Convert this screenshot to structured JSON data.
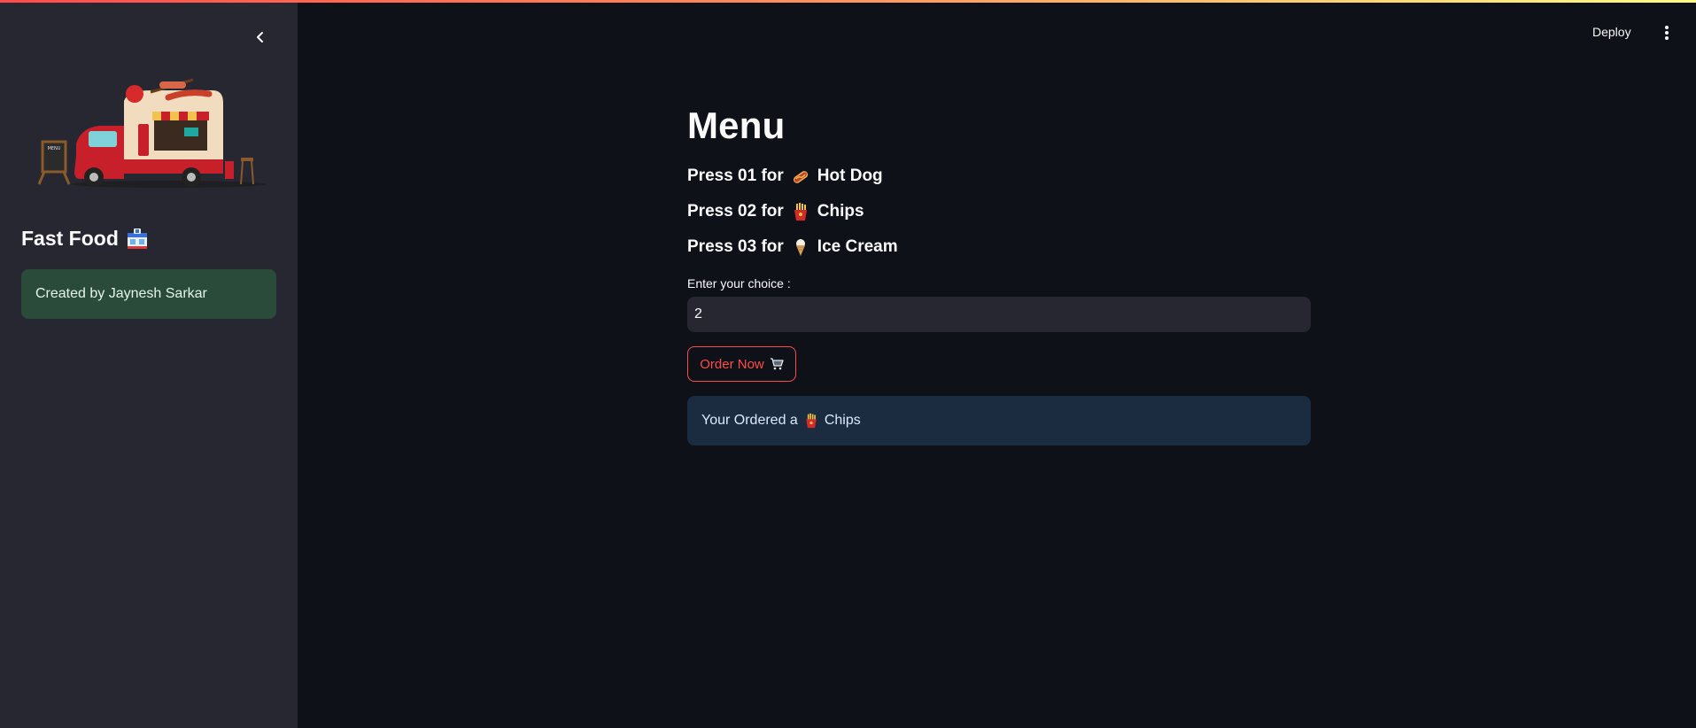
{
  "sidebar": {
    "title": "Fast Food",
    "title_icon": "convenience-store-icon",
    "banner_image": "food-truck-illustration",
    "credit": "Created by Jaynesh Sarkar"
  },
  "header": {
    "deploy_label": "Deploy",
    "menu_icon": "vertical-ellipsis-icon"
  },
  "main": {
    "title": "Menu",
    "items": [
      {
        "prefix": "Press 01 for",
        "icon": "hot-dog-icon",
        "name": "Hot Dog"
      },
      {
        "prefix": "Press 02 for",
        "icon": "french-fries-icon",
        "name": "Chips"
      },
      {
        "prefix": "Press 03 for",
        "icon": "ice-cream-icon",
        "name": "Ice Cream"
      }
    ],
    "input": {
      "label": "Enter your choice :",
      "value": "2"
    },
    "order_button": {
      "label": "Order Now",
      "icon": "shopping-cart-icon"
    },
    "result": {
      "text_prefix": "Your Ordered a",
      "icon": "french-fries-icon",
      "item": "Chips"
    }
  },
  "colors": {
    "background": "#0e1117",
    "sidebar": "#262730",
    "accent": "#ff4b4b",
    "success_box": "#2a4a3a",
    "info_box": "#1b2b40"
  }
}
